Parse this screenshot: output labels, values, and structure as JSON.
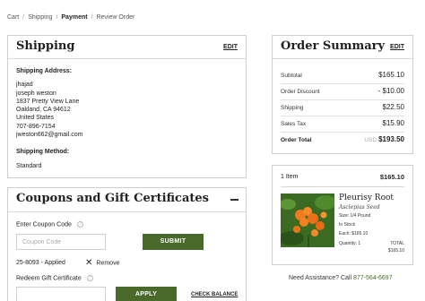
{
  "breadcrumb": {
    "items": [
      "Cart",
      "Shipping",
      "Payment",
      "Review Order"
    ],
    "separator": "/"
  },
  "shipping": {
    "title": "Shipping",
    "edit_label": "EDIT",
    "address_label": "Shipping Address:",
    "address_lines": [
      "jhajad",
      "joseph weston",
      "1837 Pretty View Lane",
      "Oakland, CA 94612",
      "United States",
      "707-896-7154",
      "jweston662@gmail.com"
    ],
    "method_label": "Shipping Method:",
    "method_value": "Standard"
  },
  "coupons": {
    "title": "Coupons and Gift Certificates",
    "coupon_label": "Enter Coupon Code",
    "coupon_placeholder": "Coupon Code",
    "submit_label": "SUBMIT",
    "applied_text": "25-8093 - Applied",
    "remove_label": "Remove",
    "gift_label": "Redeem Gift Certificate",
    "apply_label": "APPLY",
    "check_balance_label": "CHECK BALANCE"
  },
  "summary": {
    "title": "Order Summary",
    "edit_label": "EDIT",
    "rows": [
      {
        "label": "Subtotal",
        "value": "$165.10"
      },
      {
        "label": "Order Discount",
        "value": "- $10.00"
      },
      {
        "label": "Shipping",
        "value": "$22.50"
      },
      {
        "label": "Sales Tax",
        "value": "$15.90"
      }
    ],
    "total": {
      "label": "Order Total",
      "currency": "USD",
      "value": "$193.50"
    }
  },
  "items": {
    "count_label": "1 Item",
    "amount": "$165.10",
    "product": {
      "name": "Pleurisy Root",
      "latin": "Asclepias Seed",
      "size": "Size: 1/4 Pound",
      "stock": "In Stock",
      "each": "Each: $165.10",
      "quantity": "Quantity: 1",
      "total_label": "TOTAL",
      "total_value": "$165.10"
    }
  },
  "assistance": {
    "text": "Need Assistance? Call",
    "phone": "877-564-6697"
  },
  "colors": {
    "accent_green": "#4a6a2c",
    "border": "#cfcfcf"
  }
}
